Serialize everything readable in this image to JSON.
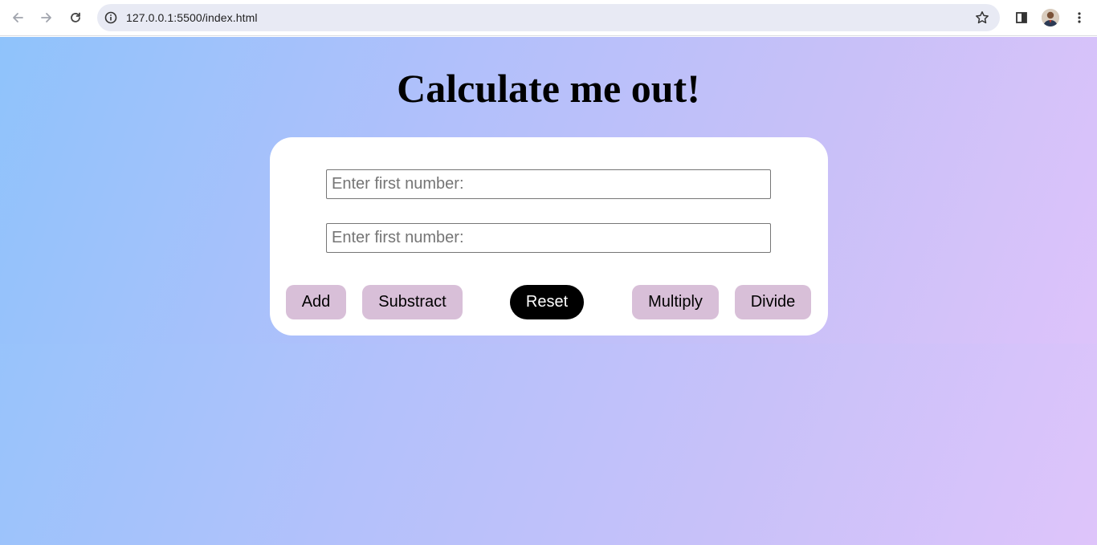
{
  "browser": {
    "url": "127.0.0.1:5500/index.html",
    "icons": [
      "back-arrow-icon",
      "forward-arrow-icon",
      "reload-icon",
      "site-info-icon",
      "bookmark-star-icon",
      "side-panel-icon",
      "profile-avatar",
      "more-menu-icon"
    ]
  },
  "page": {
    "title": "Calculate me out!",
    "inputs": [
      {
        "placeholder": "Enter first number:",
        "value": ""
      },
      {
        "placeholder": "Enter first number:",
        "value": ""
      }
    ],
    "buttons": {
      "add": "Add",
      "subtract": "Substract",
      "reset": "Reset",
      "multiply": "Multiply",
      "divide": "Divide"
    }
  },
  "colors": {
    "gradient_start": "#90c4fb",
    "gradient_end": "#dec4fa",
    "card": "#ffffff",
    "op_button": "#d8bfd8",
    "reset_button": "#000000"
  }
}
